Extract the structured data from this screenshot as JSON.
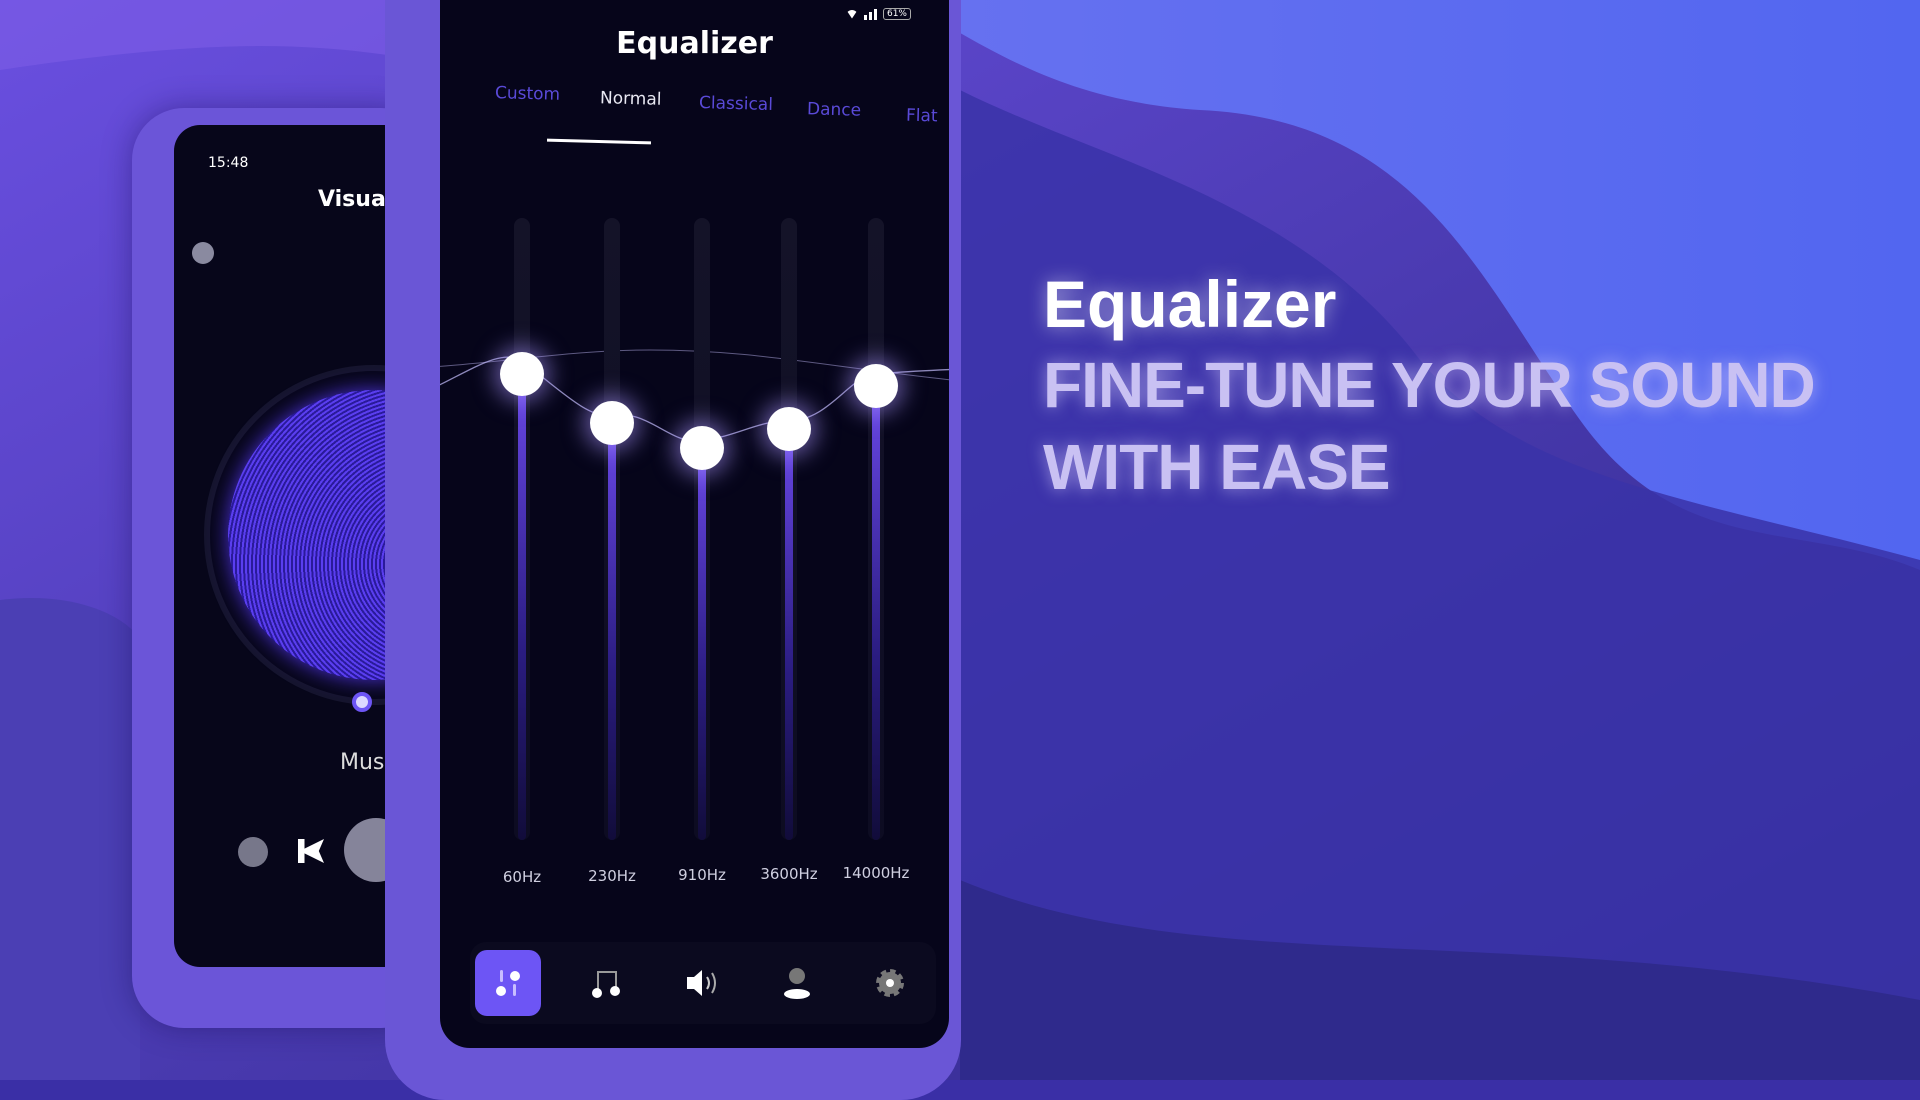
{
  "colors": {
    "accent": "#6d55f5",
    "background_dark": "#2c2784",
    "background_light": "#5d6ff2",
    "tab_inactive": "#5a4ad8",
    "headline_sub": "#c9c1f3"
  },
  "back_phone": {
    "time": "15:48",
    "title": "Visual",
    "track_label": "Mus",
    "icons": [
      "timer-icon",
      "repeat-icon",
      "previous-icon",
      "play-icon"
    ]
  },
  "front_phone": {
    "status_bar": {
      "battery": "61%",
      "icons": [
        "wifi-icon",
        "signal-icon",
        "battery-icon"
      ]
    },
    "title": "Equalizer",
    "tabs": [
      {
        "label": "Custom",
        "active": false
      },
      {
        "label": "Normal",
        "active": true
      },
      {
        "label": "Classical",
        "active": false
      },
      {
        "label": "Dance",
        "active": false
      },
      {
        "label": "Flat",
        "active": false
      }
    ],
    "bands": [
      {
        "label": "60Hz",
        "level": 0.75
      },
      {
        "label": "230Hz",
        "level": 0.67
      },
      {
        "label": "910Hz",
        "level": 0.63
      },
      {
        "label": "3600Hz",
        "level": 0.66
      },
      {
        "label": "14000Hz",
        "level": 0.73
      }
    ],
    "nav": [
      {
        "icon": "equalizer-icon",
        "active": true
      },
      {
        "icon": "music-note-icon",
        "active": false
      },
      {
        "icon": "speaker-icon",
        "active": false
      },
      {
        "icon": "user-icon",
        "active": false
      },
      {
        "icon": "gear-icon",
        "active": false
      }
    ]
  },
  "headline": {
    "title": "Equalizer",
    "line1": "FINE-TUNE YOUR SOUND",
    "line2": "WITH EASE"
  }
}
